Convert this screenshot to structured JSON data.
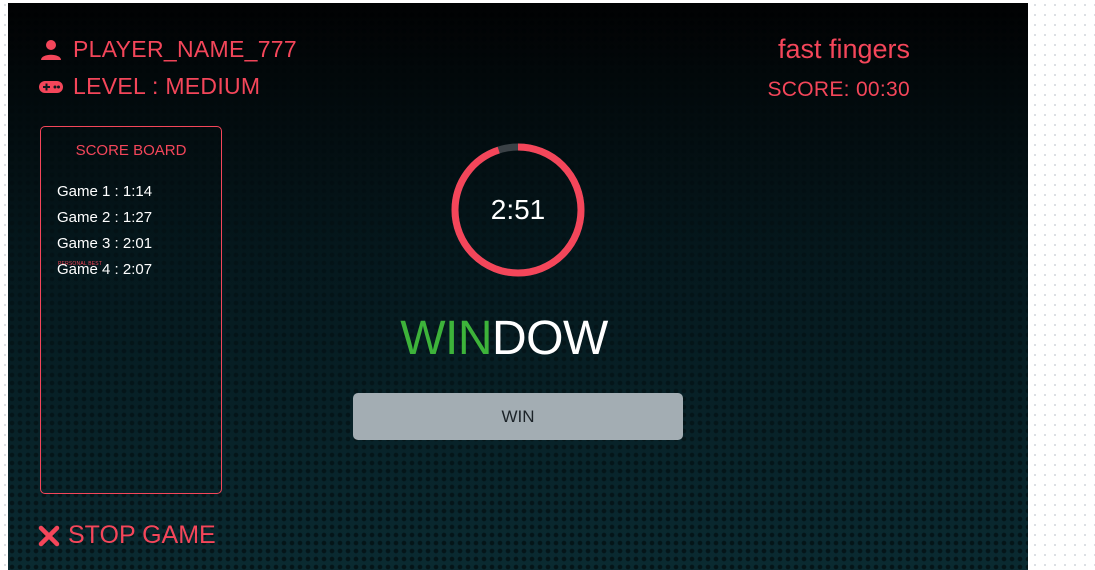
{
  "player": {
    "name": "PLAYER_NAME_777",
    "level": "LEVEL : MEDIUM",
    "icon": "user-icon",
    "level_icon": "gamepad-icon"
  },
  "app": {
    "title": "fast fingers",
    "score": "SCORE: 00:30"
  },
  "scoreboard": {
    "title": "SCORE BOARD",
    "games": [
      {
        "label": "Game 1  : 1:14"
      },
      {
        "label": "Game 2 : 1:27"
      },
      {
        "label": "Game 3 : 2:01",
        "badge": "PERSONAL BEST"
      },
      {
        "label": "Game 4 : 2:07"
      }
    ]
  },
  "timer": {
    "display": "2:51",
    "progress": 0.95
  },
  "word": {
    "typed": "WIN",
    "remaining": "DOW"
  },
  "input": {
    "value": "WIN"
  },
  "stop": {
    "label": "STOP GAME",
    "icon": "close-icon"
  },
  "colors": {
    "accent": "#f4465a",
    "typed": "#3db33a",
    "ring_track": "#3a4146",
    "input_bg": "#a3adb3"
  }
}
